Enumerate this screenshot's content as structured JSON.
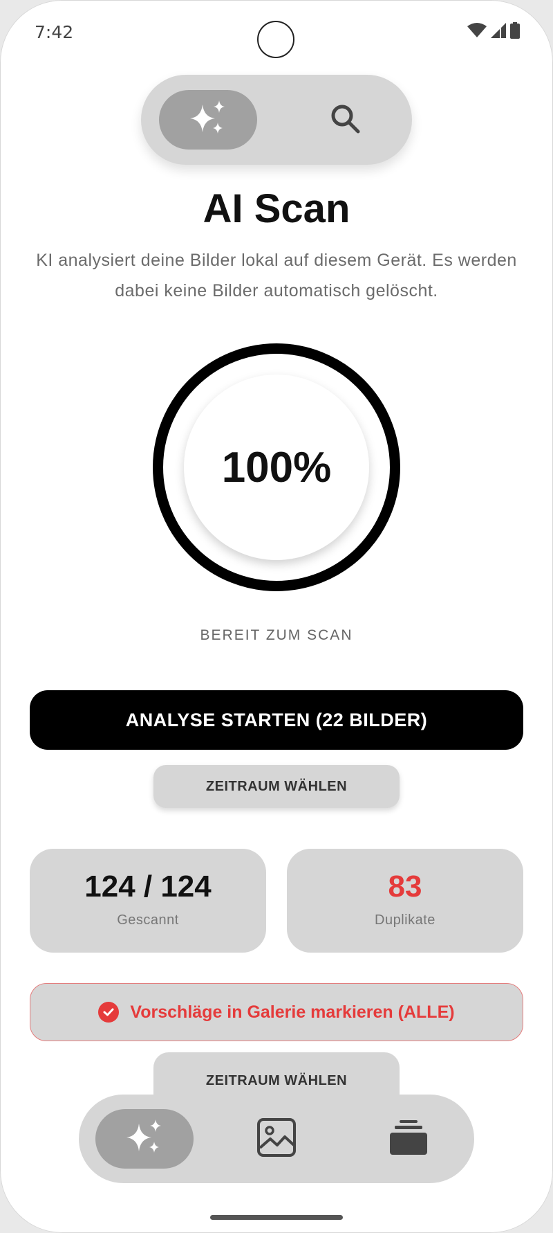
{
  "status_bar": {
    "time": "7:42",
    "icons": [
      "wifi-icon",
      "cell-signal-icon",
      "battery-icon"
    ]
  },
  "top_toggle": {
    "active": "ai-scan",
    "items": [
      "sparkles-icon",
      "search-icon"
    ]
  },
  "header": {
    "title": "AI Scan",
    "subtitle": "KI analysiert deine Bilder lokal auf diesem Gerät. Es werden dabei keine Bilder automatisch gelöscht."
  },
  "progress": {
    "value_label": "100%",
    "fraction": 1.0,
    "status": "BEREIT ZUM SCAN"
  },
  "actions": {
    "start_label": "ANALYSE STARTEN (22 BILDER)",
    "range_label": "ZEITRAUM WÄHLEN"
  },
  "stats": {
    "scanned_value": "124 / 124",
    "scanned_label": "Gescannt",
    "duplicates_value": "83",
    "duplicates_label": "Duplikate"
  },
  "mark_suggestions": {
    "label": "Vorschläge in Galerie markieren (ALLE)"
  },
  "bottom_sheet_range": {
    "label": "ZEITRAUM WÄHLEN"
  },
  "bottom_nav": {
    "active": "ai-scan",
    "items": [
      "sparkles-icon",
      "gallery-icon",
      "stack-icon"
    ]
  },
  "colors": {
    "accent_red": "#e53b3b",
    "surface": "#d6d6d6",
    "active_pill": "#a1a1a1",
    "primary": "#000000"
  }
}
